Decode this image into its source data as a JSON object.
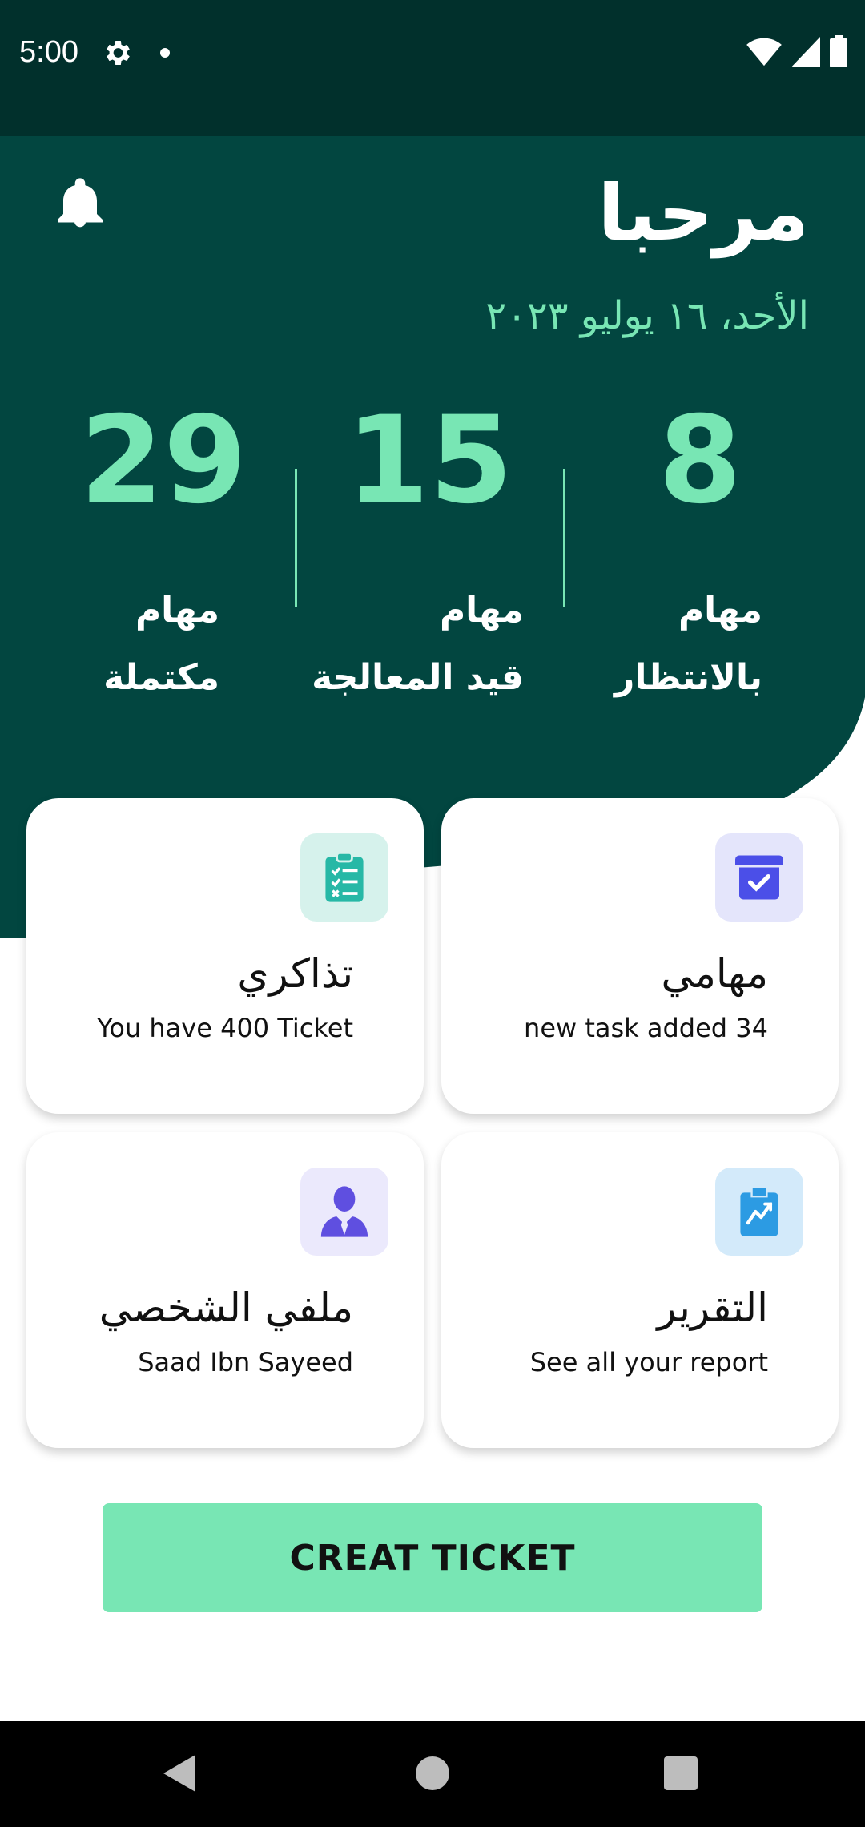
{
  "status_bar": {
    "time": "5:00"
  },
  "header": {
    "greeting": "مرحبا",
    "date": "الأحد، ١٦ يوليو ٢٠٢٣"
  },
  "stats": [
    {
      "value": "29",
      "line1": "مهام",
      "line2": "مكتملة"
    },
    {
      "value": "15",
      "line1": "مهام",
      "line2": "قيد المعالجة"
    },
    {
      "value": "8",
      "line1": "مهام",
      "line2": "بالانتظار"
    }
  ],
  "cards": {
    "tickets": {
      "title": "تذاكري",
      "subtitle": "You have 400 Ticket",
      "icon": "clipboard-checklist-icon"
    },
    "tasks": {
      "title": "مهامي",
      "subtitle": "new task added 34",
      "icon": "box-check-icon"
    },
    "profile": {
      "title": "ملفي الشخصي",
      "subtitle": "Saad Ibn Sayeed",
      "icon": "user-icon"
    },
    "report": {
      "title": "التقرير",
      "subtitle": "See all your report",
      "icon": "report-chart-icon"
    }
  },
  "create_button": {
    "label": "CREAT TICKET"
  },
  "colors": {
    "dark_green": "#024640",
    "status_bar": "#01302c",
    "accent": "#78e6b4"
  }
}
